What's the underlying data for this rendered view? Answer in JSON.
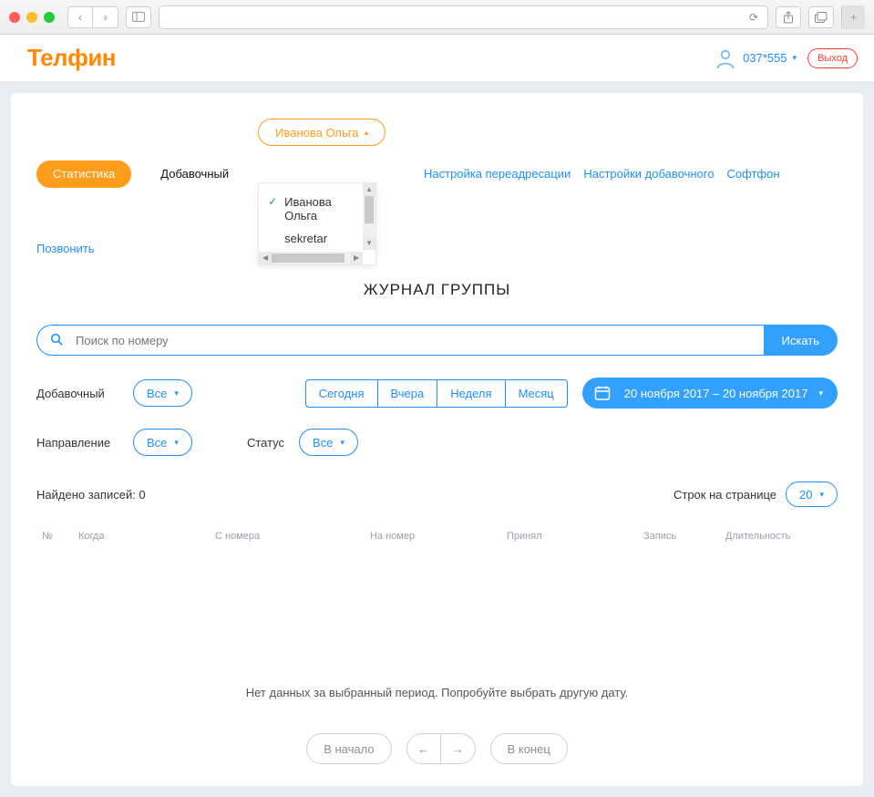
{
  "chrome": {
    "reload_glyph": "⟳",
    "share_glyph": "⇪",
    "tabs_glyph": "⧉",
    "plus_glyph": "+"
  },
  "header": {
    "logo": "Телфин",
    "user_account": "037*555",
    "logout": "Выход"
  },
  "tabs": {
    "stats": "Статистика",
    "extension": "Добавочный",
    "user_select": "Иванова Ольга",
    "links": {
      "forwarding": "Настройка переадресации",
      "ext_settings": "Настройки добавочного",
      "softphone": "Софтфон",
      "call": "Позвонить"
    }
  },
  "user_dropdown": {
    "items": [
      "Иванова Ольга",
      "sekretar"
    ],
    "selected_index": 0
  },
  "page_title": "ЖУРНАЛ ГРУППЫ",
  "search": {
    "placeholder": "Поиск по номеру",
    "button": "Искать"
  },
  "filters": {
    "extension_label": "Добавочный",
    "extension_value": "Все",
    "direction_label": "Направление",
    "direction_value": "Все",
    "status_label": "Статус",
    "status_value": "Все",
    "periods": {
      "today": "Сегодня",
      "yesterday": "Вчера",
      "week": "Неделя",
      "month": "Месяц"
    },
    "date_range": "20 ноября 2017 – 20 ноября 2017"
  },
  "results": {
    "found_label": "Найдено записей: 0",
    "perpage_label": "Строк на странице",
    "perpage_value": "20"
  },
  "columns": {
    "no": "№",
    "when": "Когда",
    "from": "С номера",
    "to": "На номер",
    "received": "Принял",
    "record": "Запись",
    "duration": "Длительность"
  },
  "empty_message": "Нет данных за выбранный период. Попробуйте выбрать другую дату.",
  "pager": {
    "first": "В начало",
    "last": "В конец",
    "prev": "←",
    "next": "→"
  }
}
